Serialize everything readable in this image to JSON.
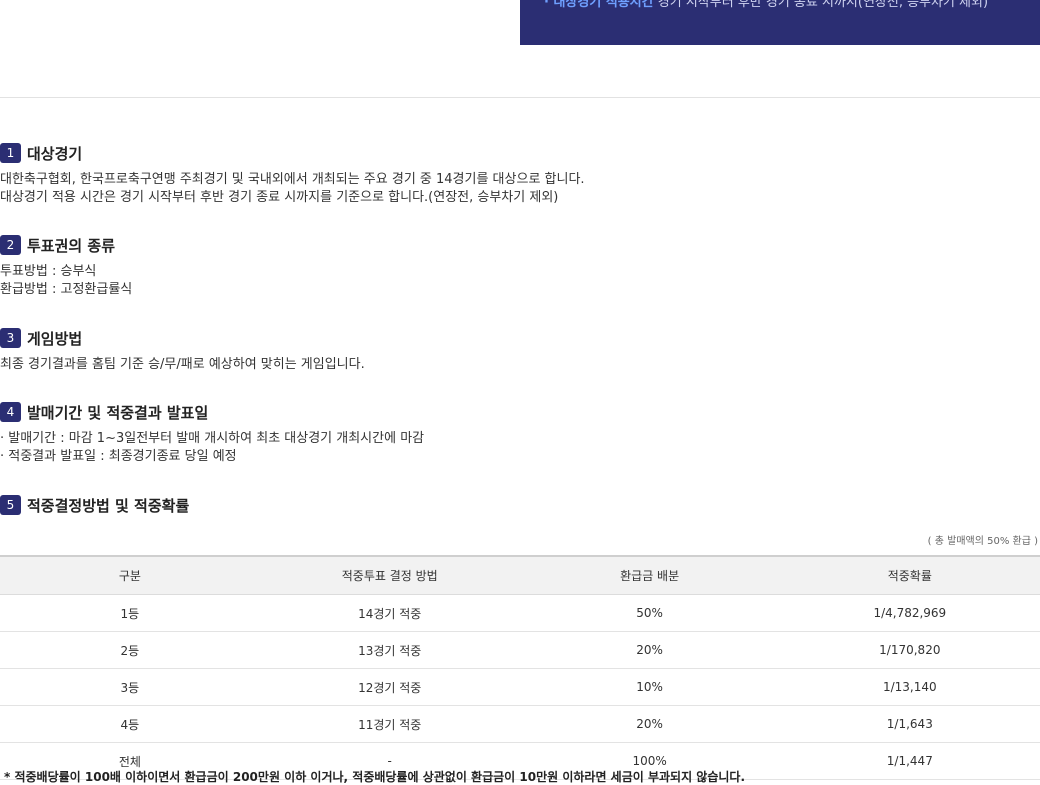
{
  "banner": {
    "note_prefix": "· 대상경기 적용시간",
    "note_text": " 경기 시작부터 후반 경기 종료 시까지(연장전, 승부차기 제외)"
  },
  "sections": [
    {
      "num": "1",
      "title": "대상경기",
      "lines": [
        "대한축구협회, 한국프로축구연맹 주최경기 및 국내외에서 개최되는 주요 경기 중 14경기를 대상으로 합니다.",
        "대상경기 적용 시간은 경기 시작부터 후반 경기 종료 시까지를 기준으로 합니다.(연장전, 승부차기 제외)"
      ]
    },
    {
      "num": "2",
      "title": "투표권의 종류",
      "lines": [
        "투표방법 : 승부식",
        "환급방법 : 고정환급률식"
      ]
    },
    {
      "num": "3",
      "title": "게임방법",
      "lines": [
        "최종 경기결과를 홈팀 기준 승/무/패로 예상하여 맞히는 게임입니다."
      ]
    },
    {
      "num": "4",
      "title": "발매기간 및 적중결과 발표일",
      "lines": [
        "· 발매기간 : 마감 1~3일전부터 발매 개시하여 최초 대상경기 개최시간에 마감",
        "· 적중결과 발표일 : 최종경기종료 당일 예정"
      ]
    },
    {
      "num": "5",
      "title": "적중결정방법 및 적중확률",
      "lines": []
    }
  ],
  "table_note": "( 총 발매액의 50% 환급 )",
  "table": {
    "headers": [
      "구분",
      "적중투표 결정 방법",
      "환급금 배분",
      "적중확률"
    ],
    "rows": [
      [
        "1등",
        "14경기 적중",
        "50%",
        "1/4,782,969"
      ],
      [
        "2등",
        "13경기 적중",
        "20%",
        "1/170,820"
      ],
      [
        "3등",
        "12경기 적중",
        "10%",
        "1/13,140"
      ],
      [
        "4등",
        "11경기 적중",
        "20%",
        "1/1,643"
      ],
      [
        "전체",
        "-",
        "100%",
        "1/1,447"
      ]
    ]
  },
  "footer_note": "* 적중배당률이 100배 이하이면서 환급금이 200만원 이하 이거나, 적중배당률에 상관없이 환급금이 10만원 이하라면 세금이 부과되지 않습니다."
}
